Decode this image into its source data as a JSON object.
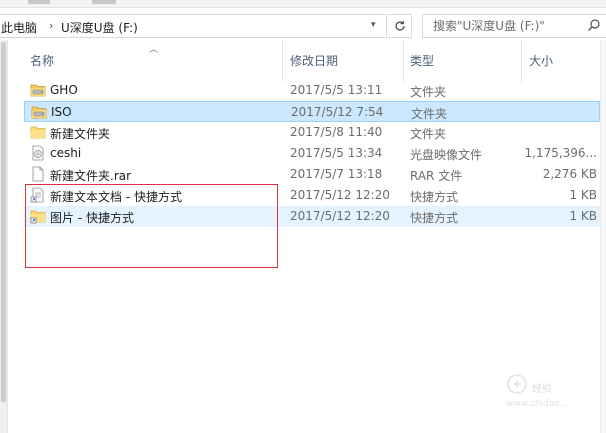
{
  "address": {
    "crumbs": [
      "此电脑",
      "U深度U盘 (F:)"
    ]
  },
  "search": {
    "placeholder": "搜索\"U深度U盘 (F:)\""
  },
  "columns": {
    "name": "名称",
    "modified": "修改日期",
    "type": "类型",
    "size": "大小"
  },
  "files": [
    {
      "name": "GHO",
      "modified": "2017/5/5 13:11",
      "type": "文件夹",
      "size": "",
      "icon": "drive-folder-icon"
    },
    {
      "name": "ISO",
      "modified": "2017/5/12 7:54",
      "type": "文件夹",
      "size": "",
      "icon": "drive-folder-icon"
    },
    {
      "name": "新建文件夹",
      "modified": "2017/5/8 11:40",
      "type": "文件夹",
      "size": "",
      "icon": "folder-icon"
    },
    {
      "name": "ceshi",
      "modified": "2017/5/5 13:34",
      "type": "光盘映像文件",
      "size": "1,175,396...",
      "icon": "disc-image-icon"
    },
    {
      "name": "新建文件夹.rar",
      "modified": "2017/5/7 13:18",
      "type": "RAR 文件",
      "size": "2,276 KB",
      "icon": "file-icon"
    },
    {
      "name": "新建文本文档 - 快捷方式",
      "modified": "2017/5/12 12:20",
      "type": "快捷方式",
      "size": "1 KB",
      "icon": "text-shortcut-icon"
    },
    {
      "name": "图片 - 快捷方式",
      "modified": "2017/5/12 12:20",
      "type": "快捷方式",
      "size": "1 KB",
      "icon": "folder-shortcut-icon"
    }
  ],
  "selected_index": 1,
  "hover_index": 6,
  "watermark": {
    "text": "经验",
    "url": "www.zhidao..."
  },
  "colors": {
    "selection": "#cce8ff",
    "highlight_box": "#d8323c",
    "header_text": "#4c607a"
  }
}
